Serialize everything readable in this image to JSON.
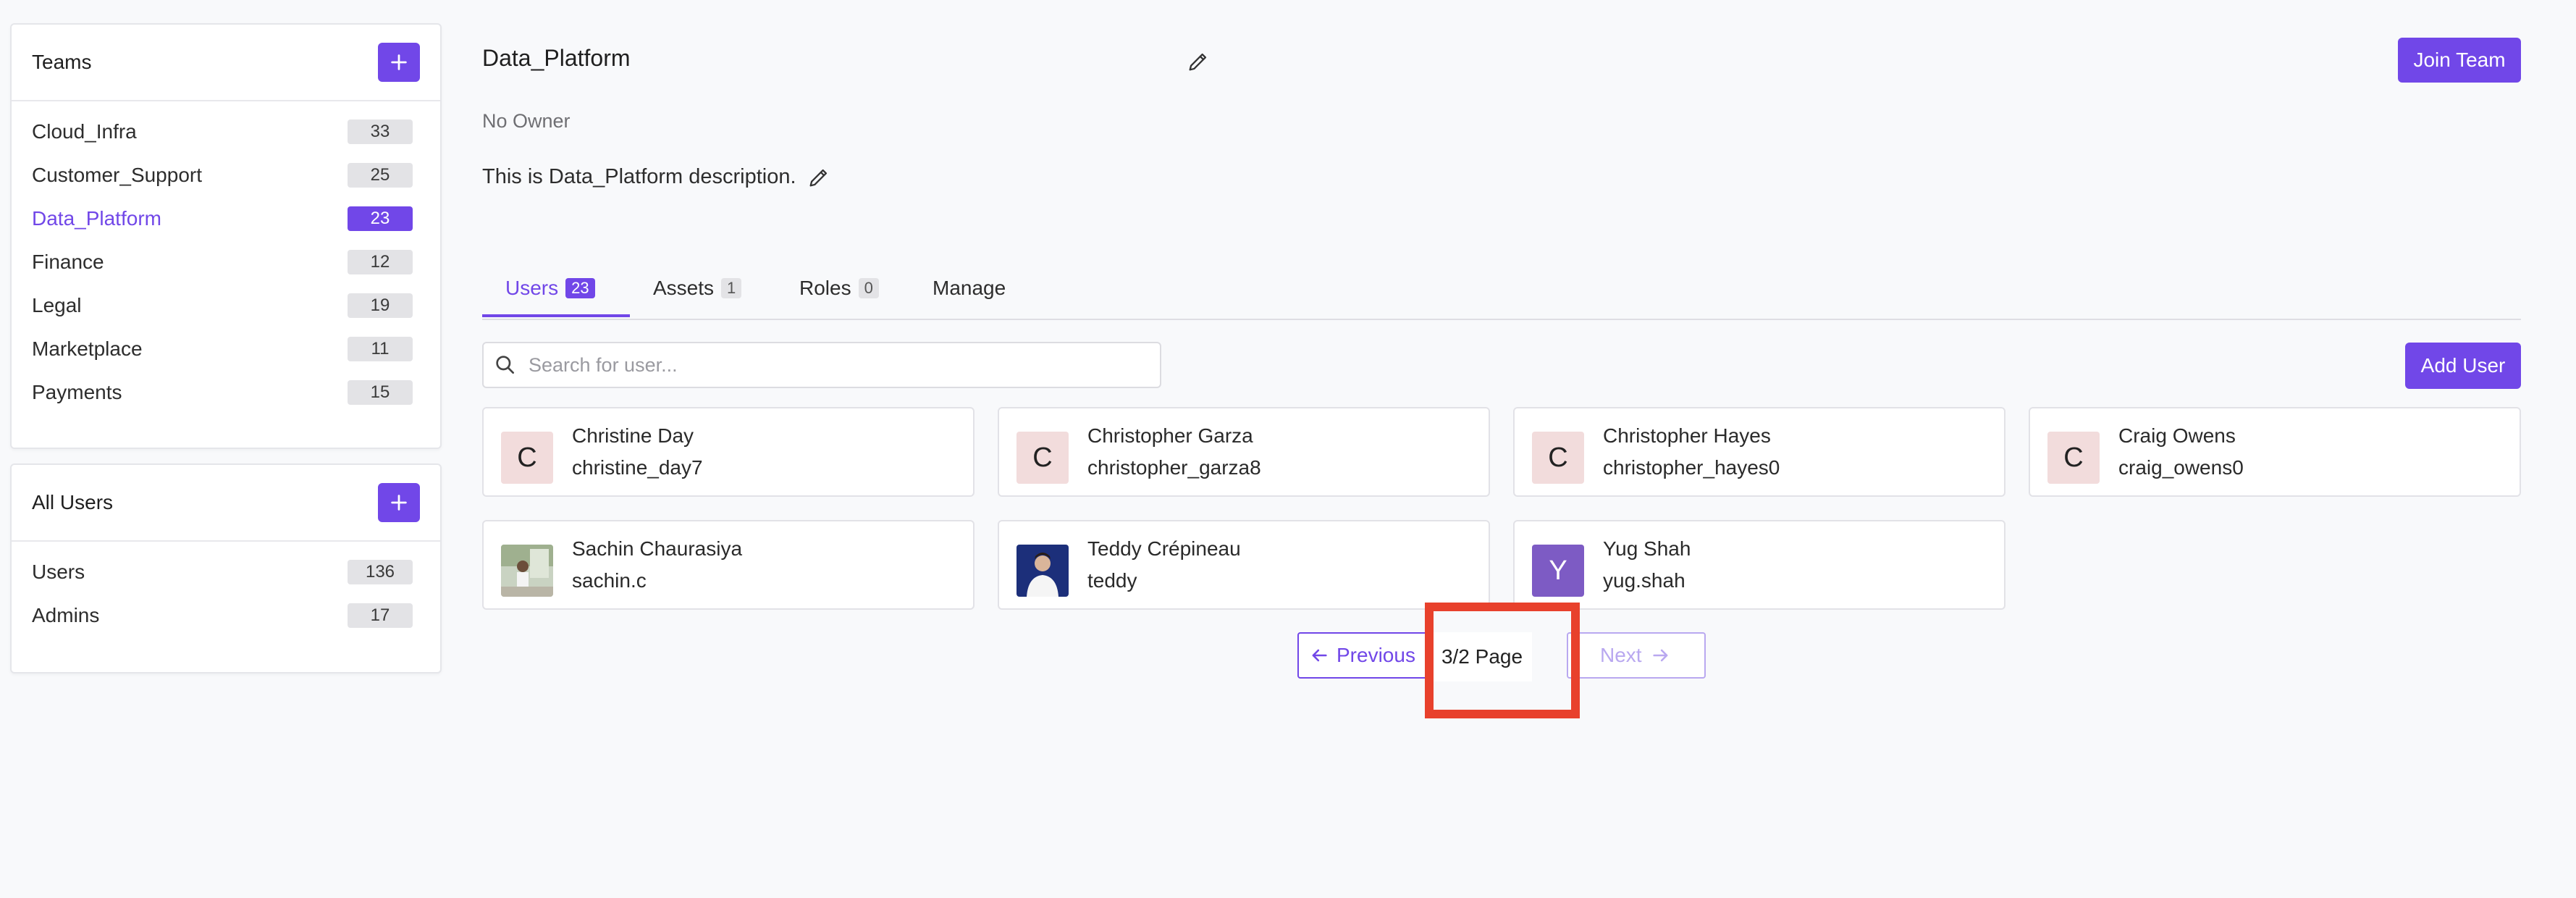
{
  "teams_panel": {
    "title": "Teams",
    "items": [
      {
        "label": "Cloud_Infra",
        "count": "33"
      },
      {
        "label": "Customer_Support",
        "count": "25"
      },
      {
        "label": "Data_Platform",
        "count": "23",
        "active": true
      },
      {
        "label": "Finance",
        "count": "12"
      },
      {
        "label": "Legal",
        "count": "19"
      },
      {
        "label": "Marketplace",
        "count": "11"
      },
      {
        "label": "Payments",
        "count": "15"
      }
    ]
  },
  "users_panel": {
    "title": "All Users",
    "items": [
      {
        "label": "Users",
        "count": "136"
      },
      {
        "label": "Admins",
        "count": "17"
      }
    ]
  },
  "team": {
    "name": "Data_Platform",
    "owner": "No Owner",
    "description": "This is Data_Platform description.",
    "join_label": "Join Team"
  },
  "tabs": [
    {
      "label": "Users",
      "count": "23",
      "active": true
    },
    {
      "label": "Assets",
      "count": "1"
    },
    {
      "label": "Roles",
      "count": "0"
    },
    {
      "label": "Manage",
      "count": ""
    }
  ],
  "search": {
    "placeholder": "Search for user..."
  },
  "add_user_label": "Add User",
  "users": [
    {
      "name": "Christine Day",
      "handle": "christine_day7",
      "initial": "C"
    },
    {
      "name": "Christopher Garza",
      "handle": "christopher_garza8",
      "initial": "C"
    },
    {
      "name": "Christopher Hayes",
      "handle": "christopher_hayes0",
      "initial": "C"
    },
    {
      "name": "Craig Owens",
      "handle": "craig_owens0",
      "initial": "C"
    },
    {
      "name": "Sachin Chaurasiya",
      "handle": "sachin.c",
      "initial": ""
    },
    {
      "name": "Teddy Crépineau",
      "handle": "teddy",
      "initial": ""
    },
    {
      "name": "Yug Shah",
      "handle": "yug.shah",
      "initial": "Y"
    }
  ],
  "pagination": {
    "previous_label": "Previous",
    "page_label": "3/2 Page",
    "next_label": "Next"
  },
  "colors": {
    "accent": "#7147e8",
    "highlight": "#e8412c"
  }
}
